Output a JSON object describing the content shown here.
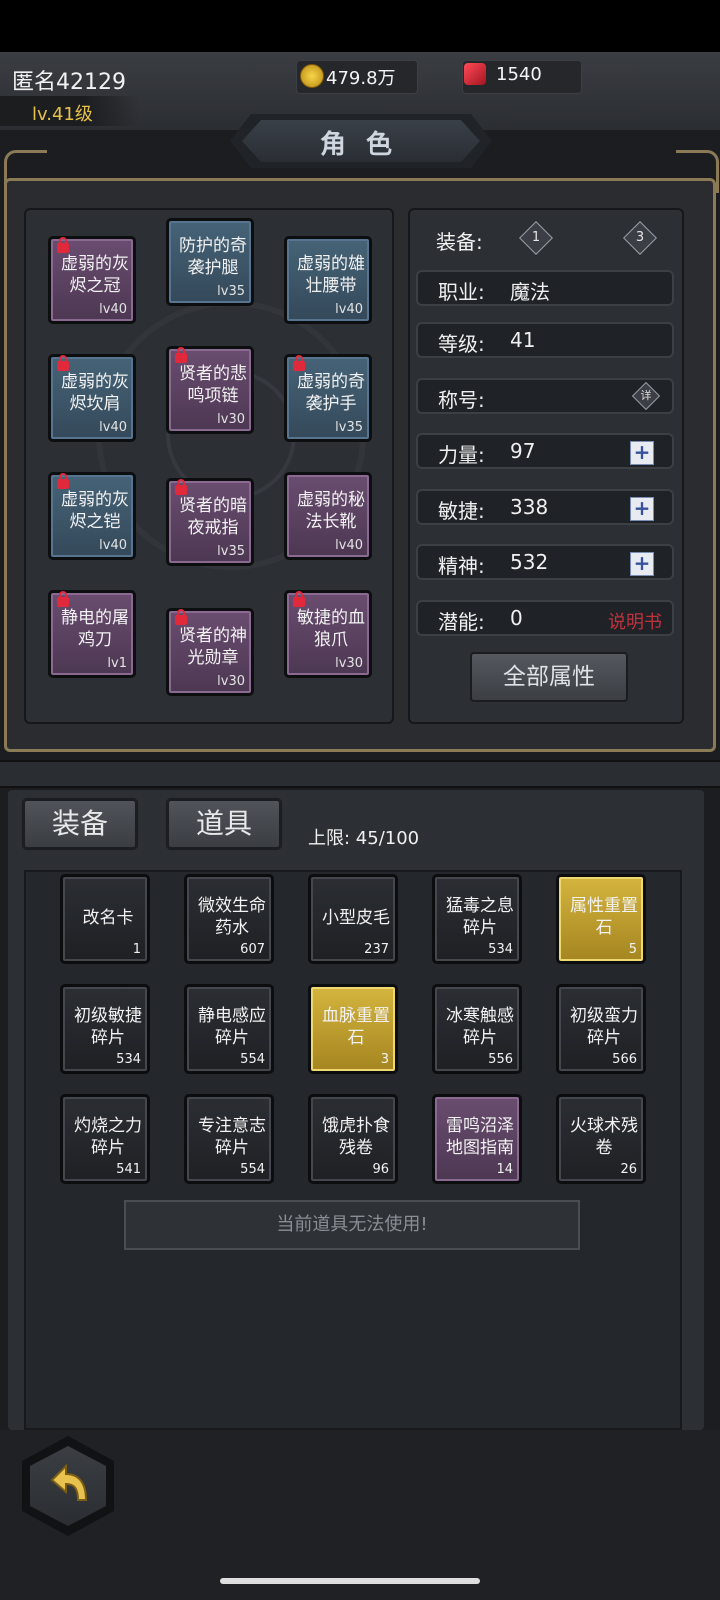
{
  "player": {
    "name": "匿名42129",
    "level": "lv.41级"
  },
  "resources": {
    "gold": "479.8万",
    "gems": "1540"
  },
  "title": "角色",
  "equipment_slots": [
    {
      "name": "虚弱的灰烬之冠",
      "lv": "lv40",
      "rarity": "purple",
      "locked": true
    },
    {
      "name": "防护的奇袭护腿",
      "lv": "lv35",
      "rarity": "blue",
      "locked": false
    },
    {
      "name": "虚弱的雄壮腰带",
      "lv": "lv40",
      "rarity": "blue",
      "locked": false
    },
    {
      "name": "虚弱的灰烬坎肩",
      "lv": "lv40",
      "rarity": "blue",
      "locked": true
    },
    {
      "name": "贤者的悲鸣项链",
      "lv": "lv30",
      "rarity": "purple",
      "locked": true
    },
    {
      "name": "虚弱的奇袭护手",
      "lv": "lv35",
      "rarity": "blue",
      "locked": true
    },
    {
      "name": "虚弱的灰烬之铠",
      "lv": "lv40",
      "rarity": "blue",
      "locked": true
    },
    {
      "name": "贤者的暗夜戒指",
      "lv": "lv35",
      "rarity": "purple",
      "locked": true
    },
    {
      "name": "虚弱的秘法长靴",
      "lv": "lv40",
      "rarity": "purple",
      "locked": false
    },
    {
      "name": "静电的屠鸡刀",
      "lv": "lv1",
      "rarity": "purple",
      "locked": true
    },
    {
      "name": "贤者的神光勋章",
      "lv": "lv30",
      "rarity": "purple",
      "locked": true
    },
    {
      "name": "敏捷的血狼爪",
      "lv": "lv30",
      "rarity": "purple",
      "locked": true
    }
  ],
  "stats": {
    "equip_label": "装备:",
    "set_left": "1",
    "set_right": "3",
    "class_label": "职业:",
    "class_value": "魔法",
    "level_label": "等级:",
    "level_value": "41",
    "title_label": "称号:",
    "title_value": "",
    "detail_badge": "详",
    "str_label": "力量:",
    "str_value": "97",
    "agi_label": "敏捷:",
    "agi_value": "338",
    "spi_label": "精神:",
    "spi_value": "532",
    "pot_label": "潜能:",
    "pot_value": "0",
    "manual": "说明书",
    "plus": "+",
    "all_attributes": "全部属性"
  },
  "bag": {
    "tab_equip": "装备",
    "tab_items": "道具",
    "capacity": "上限: 45/100",
    "items": [
      {
        "name": "改名卡",
        "count": "1",
        "style": "dark"
      },
      {
        "name": "微效生命药水",
        "count": "607",
        "style": "dark"
      },
      {
        "name": "小型皮毛",
        "count": "237",
        "style": "dark"
      },
      {
        "name": "猛毒之息碎片",
        "count": "534",
        "style": "dark"
      },
      {
        "name": "属性重置石",
        "count": "5",
        "style": "gold"
      },
      {
        "name": "初级敏捷碎片",
        "count": "534",
        "style": "dark"
      },
      {
        "name": "静电感应碎片",
        "count": "554",
        "style": "dark"
      },
      {
        "name": "血脉重置石",
        "count": "3",
        "style": "gold"
      },
      {
        "name": "冰寒触感碎片",
        "count": "556",
        "style": "dark"
      },
      {
        "name": "初级蛮力碎片",
        "count": "566",
        "style": "dark"
      },
      {
        "name": "灼烧之力碎片",
        "count": "541",
        "style": "dark"
      },
      {
        "name": "专注意志碎片",
        "count": "554",
        "style": "dark"
      },
      {
        "name": "饿虎扑食残卷",
        "count": "96",
        "style": "dark"
      },
      {
        "name": "雷鸣沼泽地图指南",
        "count": "14",
        "style": "purple"
      },
      {
        "name": "火球术残卷",
        "count": "26",
        "style": "dark"
      }
    ],
    "hint": "当前道具无法使用!"
  }
}
